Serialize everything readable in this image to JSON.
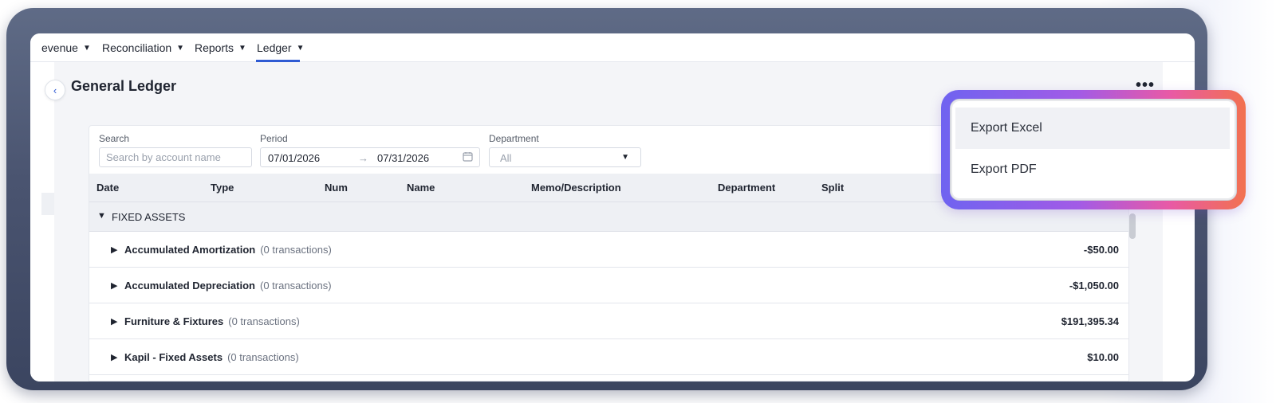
{
  "nav": {
    "items": [
      {
        "label": "evenue"
      },
      {
        "label": "Reconciliation"
      },
      {
        "label": "Reports"
      },
      {
        "label": "Ledger"
      }
    ],
    "active": "Ledger"
  },
  "page": {
    "title": "General Ledger",
    "more_icon": "ellipsis-icon",
    "collapse_icon": "chevron-left-icon"
  },
  "filters": {
    "search_label": "Search",
    "search_placeholder": "Search by account name",
    "period_label": "Period",
    "period_start": "07/01/2026",
    "period_end": "07/31/2026",
    "department_label": "Department",
    "department_value": "All"
  },
  "table": {
    "columns": [
      "Date",
      "Type",
      "Num",
      "Name",
      "Memo/Description",
      "Department",
      "Split"
    ],
    "group": "FIXED ASSETS",
    "rows": [
      {
        "account": "Accumulated Amortization",
        "count": "(0 transactions)",
        "amount": "-$50.00"
      },
      {
        "account": "Accumulated Depreciation",
        "count": "(0 transactions)",
        "amount": "-$1,050.00"
      },
      {
        "account": "Furniture & Fixtures",
        "count": "(0 transactions)",
        "amount": "$191,395.34"
      },
      {
        "account": "Kapil - Fixed Assets",
        "count": "(0 transactions)",
        "amount": "$10.00"
      }
    ]
  },
  "menu": {
    "items": [
      {
        "label": "Export Excel"
      },
      {
        "label": "Export PDF"
      }
    ]
  },
  "colors": {
    "accent": "#2f5bd3",
    "highlight_gradient_start": "#6f63f0",
    "highlight_gradient_end": "#f2714f"
  }
}
